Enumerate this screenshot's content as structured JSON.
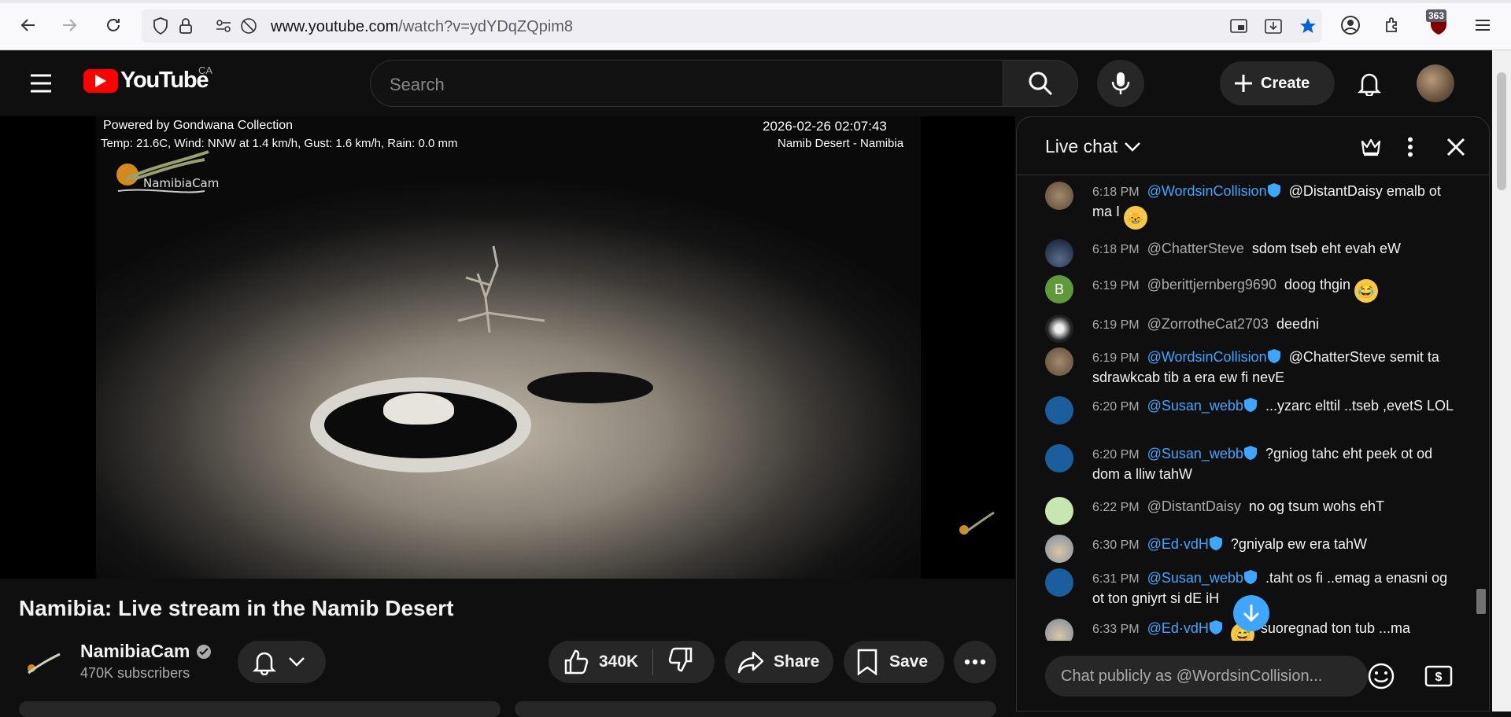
{
  "browser": {
    "url_host": "www.youtube.com",
    "url_path": "/watch?v=ydYDqZQpim8",
    "extension_badge": "363"
  },
  "header": {
    "logo_text": "YouTube",
    "region": "CA",
    "search_placeholder": "Search",
    "create_label": "Create"
  },
  "video": {
    "overlay_top_left_1": "Powered by Gondwana Collection",
    "overlay_top_left_2": "Temp: 21.6C, Wind: NNW at 1.4 km/h, Gust: 1.6 km/h, Rain: 0.0 mm",
    "overlay_top_right_1": "2026-02-26 02:07:43",
    "overlay_top_right_2": "Namib Desert - Namibia",
    "cam_logo_text": "NamibiaCam"
  },
  "details": {
    "title": "Namibia: Live stream in the Namib Desert",
    "channel_name": "NamibiaCam",
    "subscribers": "470K subscribers",
    "likes": "340K",
    "share_label": "Share",
    "save_label": "Save"
  },
  "chat": {
    "title": "Live chat",
    "input_placeholder": "Chat publicly as @WordsinCollision...",
    "messages": [
      {
        "time": "6:18 PM",
        "author": "@WordsinCollision",
        "text": "@DistantDaisy emalb ot ma I"
      },
      {
        "time": "6:18 PM",
        "author": "@ChatterSteve",
        "text": "sdom tseb eht evah eW"
      },
      {
        "time": "6:19 PM",
        "author": "@berittjernberg9690",
        "text": "doog thgin"
      },
      {
        "time": "6:19 PM",
        "author": "@ZorrotheCat2703",
        "text": "deedni"
      },
      {
        "time": "6:19 PM",
        "author": "@WordsinCollision",
        "text": "@ChatterSteve semit ta sdrawkcab tib a era ew fi nevE"
      },
      {
        "time": "6:20 PM",
        "author": "@Susan_webb",
        "text": "...yzarc elttil ..tseb ,evetS LOL"
      },
      {
        "time": "6:20 PM",
        "author": "@Susan_webb",
        "text": "?gniog tahc eht peek ot od dom a lliw tahW"
      },
      {
        "time": "6:22 PM",
        "author": "@DistantDaisy",
        "text": "no og tsum wohs ehT"
      },
      {
        "time": "6:30 PM",
        "author": "@Ed·vdH",
        "text": "?gniyalp ew era tahW"
      },
      {
        "time": "6:31 PM",
        "author": "@Susan_webb",
        "text": ".taht os fi ..emag a enasni og ot ton gniyrt si dE iH"
      },
      {
        "time": "6:33 PM",
        "author": "@Ed·vdH",
        "text": "suoregnad ton tub ...ma"
      }
    ],
    "avatar_b_letter": "B"
  },
  "colors": {
    "accent_blue": "#3ea6ff",
    "yt_red": "#ff0000",
    "bg": "#0f0f0f"
  }
}
